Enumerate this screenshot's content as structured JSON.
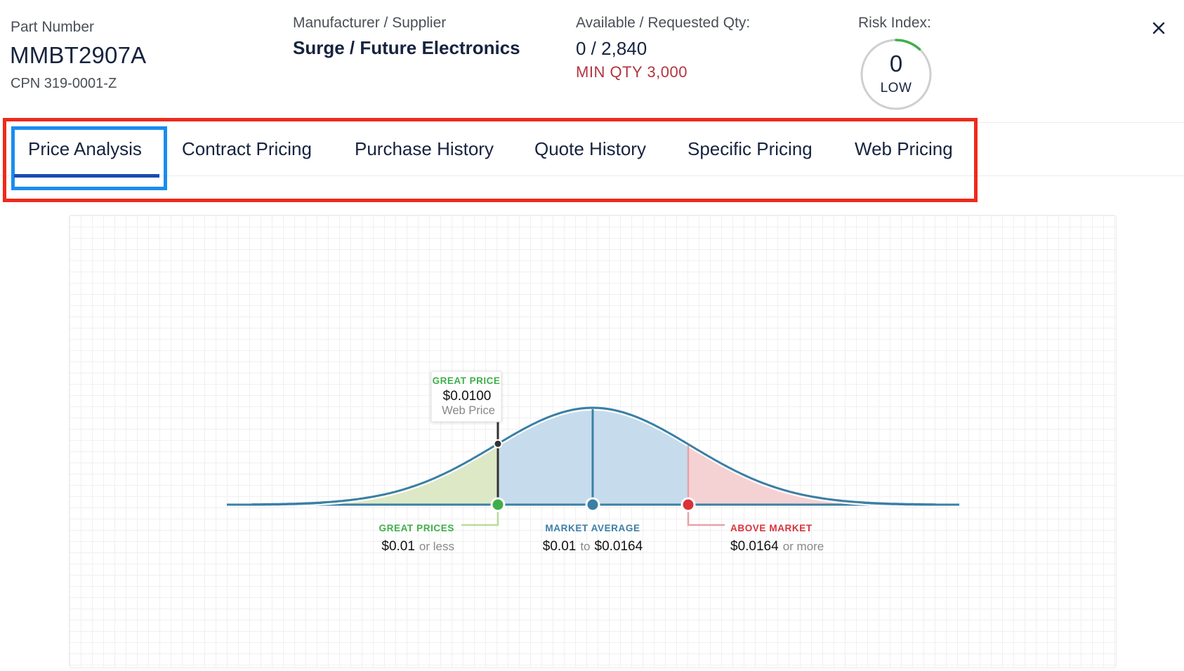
{
  "header": {
    "part_label": "Part Number",
    "part_number": "MMBT2907A",
    "cpn": "CPN 319-0001-Z",
    "manufacturer_label": "Manufacturer / Supplier",
    "manufacturer_value": "Surge / Future Electronics",
    "qty_label": "Available / Requested Qty:",
    "qty_value": "0 / 2,840",
    "min_qty": "MIN QTY 3,000",
    "risk_label": "Risk Index:",
    "risk_value": "0",
    "risk_level": "LOW",
    "risk_fraction": 0.12,
    "close_icon": "close-icon"
  },
  "tabs": [
    {
      "label": "Price Analysis",
      "active": true
    },
    {
      "label": "Contract Pricing",
      "active": false
    },
    {
      "label": "Purchase History",
      "active": false
    },
    {
      "label": "Quote History",
      "active": false
    },
    {
      "label": "Specific Pricing",
      "active": false
    },
    {
      "label": "Web Pricing",
      "active": false
    }
  ],
  "colors": {
    "great": "#3fae4a",
    "market": "#3a7fa6",
    "above": "#d9323a",
    "tab_highlight": "#ee2a1b",
    "active_tab_box": "#1a8cf0"
  },
  "chart_data": {
    "type": "area",
    "marker": {
      "title": "GREAT PRICE",
      "value": "$0.0100",
      "source": "Web Price"
    },
    "zones": [
      {
        "key": "great",
        "title": "GREAT PRICES",
        "value": "$0.01",
        "connector": "or less"
      },
      {
        "key": "market",
        "title": "MARKET AVERAGE",
        "value_low": "$0.01",
        "connector": "to",
        "value_high": "$0.0164"
      },
      {
        "key": "above",
        "title": "ABOVE MARKET",
        "value": "$0.0164",
        "connector": "or more"
      }
    ]
  }
}
